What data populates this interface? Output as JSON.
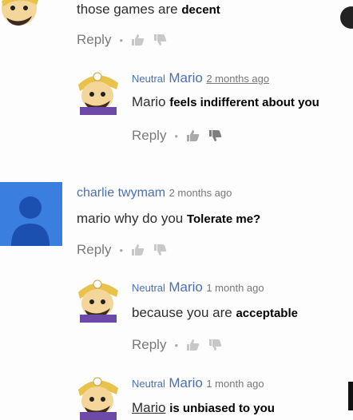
{
  "comments": [
    {
      "author": "",
      "body_plain": "those games are",
      "body_bold": "decent",
      "reply_label": "Reply",
      "separator": "•"
    },
    {
      "author_first": "Neutral",
      "author_second": "Mario",
      "timestamp": "2 months ago",
      "body_plain": "Mario",
      "body_bold": "feels indifferent about you",
      "reply_label": "Reply",
      "separator": "•"
    },
    {
      "author_first": "charlie twymam",
      "timestamp": "2 months ago",
      "body_plain": "mario why do you",
      "body_bold": "Tolerate me?",
      "reply_label": "Reply",
      "separator": "•"
    },
    {
      "author_first": "Neutral",
      "author_second": "Mario",
      "timestamp": "1 month ago",
      "body_plain": "because you are",
      "body_bold": "acceptable",
      "reply_label": "Reply",
      "separator": "•"
    },
    {
      "author_first": "Neutral",
      "author_second": "Mario",
      "timestamp": "1 month ago",
      "body_plain": "Mario",
      "body_bold": "is unbiased to you"
    }
  ],
  "icons": {
    "like": "thumbs-up-icon",
    "dislike": "thumbs-down-icon",
    "overflow": "overflow-icon",
    "user_avatar": "default-user-avatar"
  },
  "colors": {
    "author_blue": "#4a6fb5",
    "user_avatar_bg": "#3a7fe0",
    "avatar_silhouette": "#1b4fb0"
  }
}
